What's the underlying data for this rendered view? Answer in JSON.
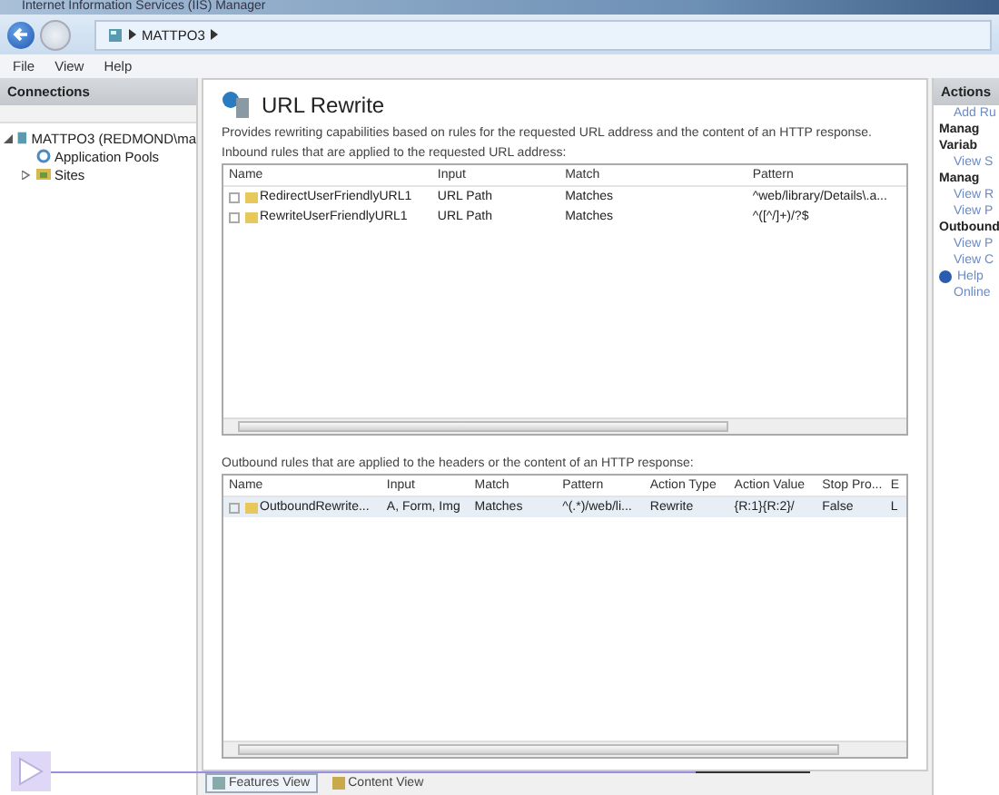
{
  "window": {
    "title": "Internet Information Services (IIS) Manager"
  },
  "address_bar": {
    "breadcrumb": [
      "MATTPO3"
    ]
  },
  "menu": [
    "File",
    "View",
    "Help"
  ],
  "connections": {
    "title": "Connections",
    "tree": [
      {
        "label": "MATTPO3 (REDMOND\\ma",
        "expanded": true,
        "children": [
          {
            "label": "Application Pools",
            "kind": "pools"
          },
          {
            "label": "Sites",
            "kind": "sites",
            "expanded": false
          }
        ]
      }
    ]
  },
  "feature": {
    "title": "URL Rewrite",
    "description": "Provides rewriting capabilities based on rules for the requested URL address and the content of an HTTP response.",
    "inbound": {
      "label": "Inbound rules that are applied to the requested URL address:",
      "columns": [
        "Name",
        "Input",
        "Match",
        "Pattern"
      ],
      "rows": [
        {
          "cells": [
            "RedirectUserFriendlyURL1",
            "URL Path",
            "Matches",
            "^web/library/Details\\.a..."
          ]
        },
        {
          "cells": [
            "RewriteUserFriendlyURL1",
            "URL Path",
            "Matches",
            "^([^/]+)/?$"
          ]
        }
      ]
    },
    "outbound": {
      "label": "Outbound rules that are applied to the headers or the content of an HTTP response:",
      "columns": [
        "Name",
        "Input",
        "Match",
        "Pattern",
        "Action Type",
        "Action Value",
        "Stop Pro...",
        "E"
      ],
      "rows": [
        {
          "cells": [
            "OutboundRewrite...",
            "A, Form, Img",
            "Matches",
            "^(.*)/web/li...",
            "Rewrite",
            "{R:1}{R:2}/",
            "False",
            "L"
          ]
        }
      ]
    }
  },
  "actions": {
    "title": "Actions",
    "items": [
      {
        "kind": "link",
        "label": "Add Ru"
      },
      {
        "kind": "heading",
        "label": "Manag"
      },
      {
        "kind": "heading",
        "label": "Variab"
      },
      {
        "kind": "link",
        "label": "View S"
      },
      {
        "kind": "heading",
        "label": "Manag"
      },
      {
        "kind": "link",
        "label": "View R"
      },
      {
        "kind": "link",
        "label": "View P"
      },
      {
        "kind": "heading",
        "label": "Outbound"
      },
      {
        "kind": "link",
        "label": "View P"
      },
      {
        "kind": "link",
        "label": "View C"
      },
      {
        "kind": "help",
        "label": "Help"
      },
      {
        "kind": "link",
        "label": "Online"
      }
    ]
  },
  "video_player": {
    "level": 0.85
  },
  "bottom_tabs": [
    {
      "label": "Features View",
      "selected": true
    },
    {
      "label": "Content View",
      "selected": false
    }
  ]
}
